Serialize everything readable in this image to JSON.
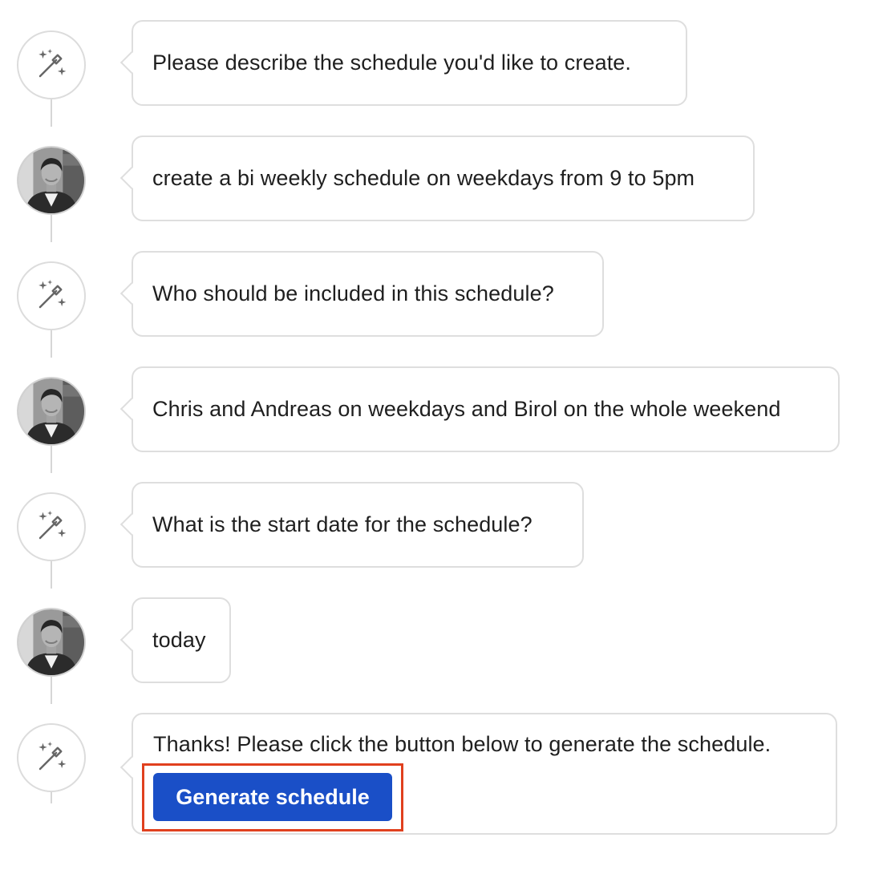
{
  "conversation": {
    "messages": [
      {
        "role": "assistant",
        "text": "Please describe the schedule you'd like to create."
      },
      {
        "role": "user",
        "text": "create a bi weekly schedule on weekdays from 9 to 5pm"
      },
      {
        "role": "assistant",
        "text": "Who should be included in this schedule?"
      },
      {
        "role": "user",
        "text": "Chris and Andreas on weekdays and Birol on the whole weekend"
      },
      {
        "role": "assistant",
        "text": "What is the start date for the schedule?"
      },
      {
        "role": "user",
        "text": "today"
      },
      {
        "role": "assistant",
        "text": "Thanks! Please click the button below to generate the schedule."
      }
    ],
    "generate_button_label": "Generate schedule"
  },
  "icons": {
    "assistant_avatar": "magic-wand-sparkles-icon",
    "user_avatar": "user-photo-avatar"
  },
  "colors": {
    "button_background": "#1a4fc7",
    "highlight_outline": "#e0401e",
    "bubble_border": "#dedede"
  }
}
